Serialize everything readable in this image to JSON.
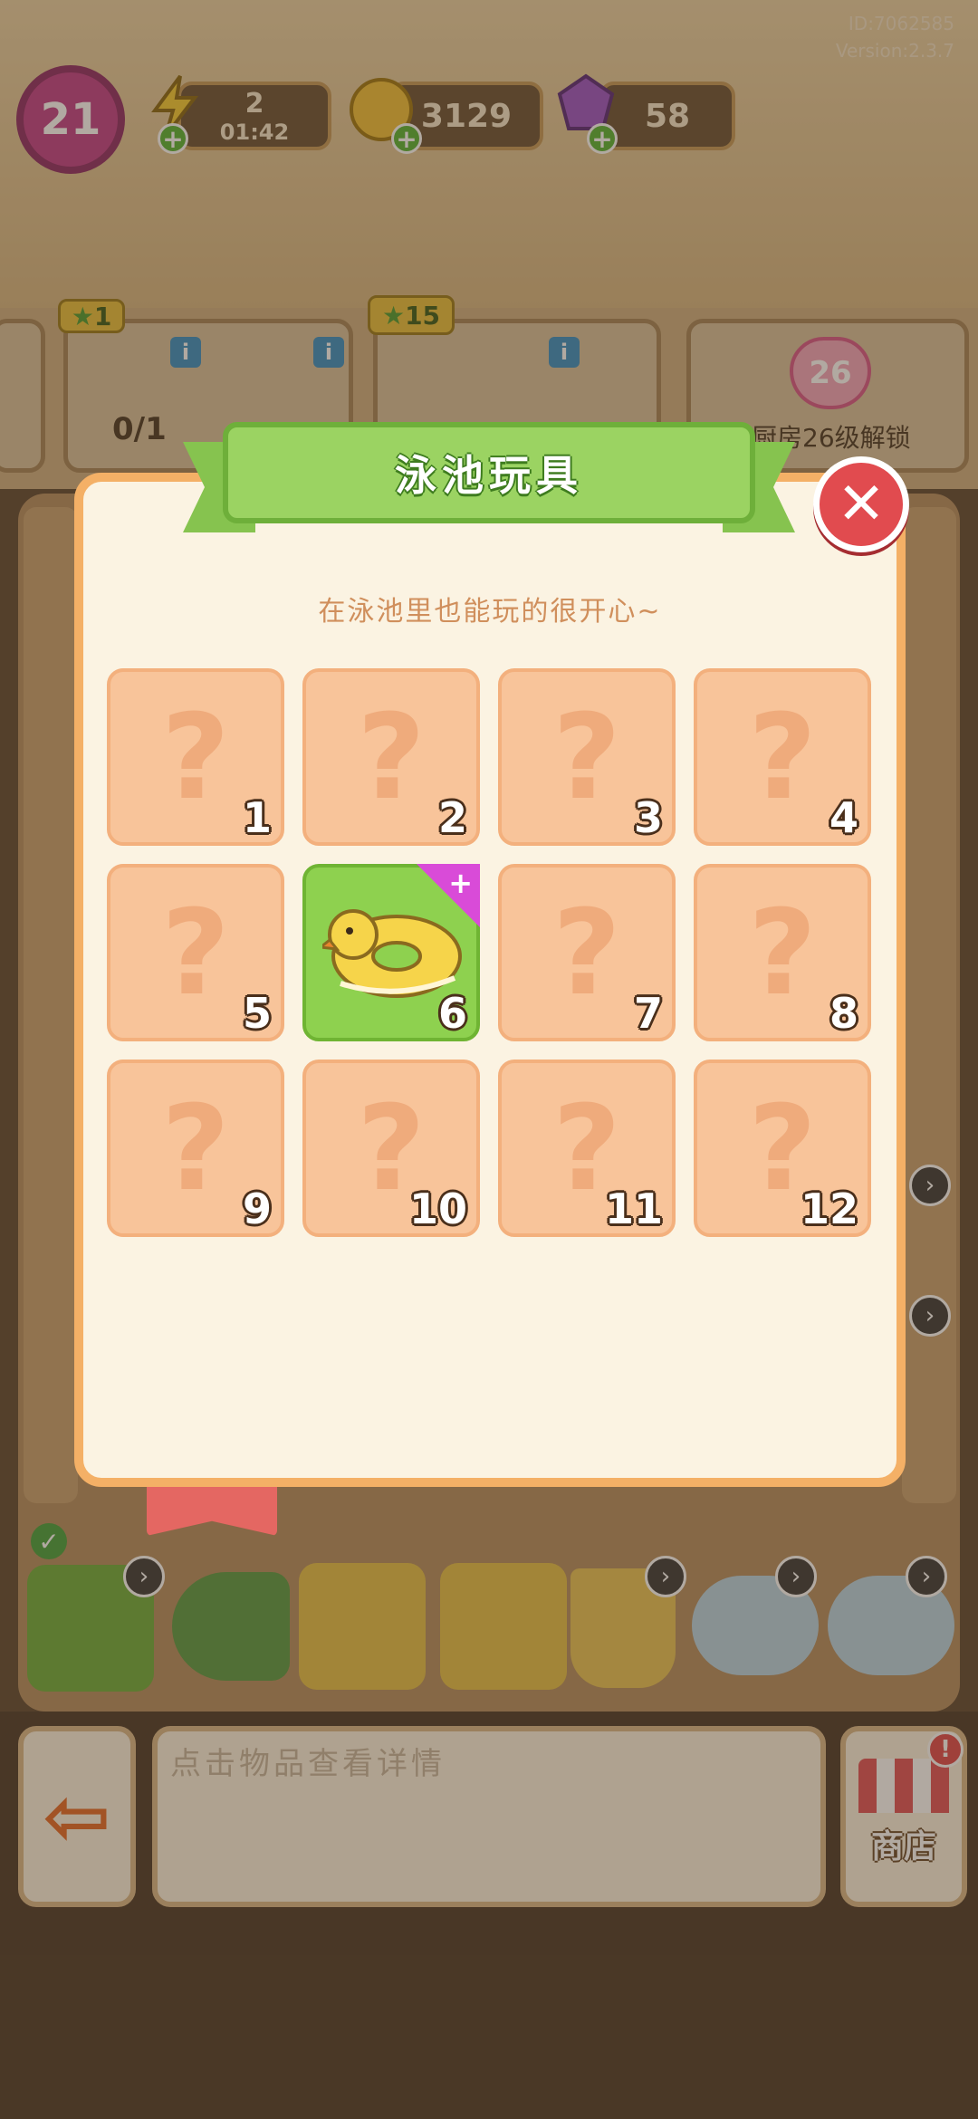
{
  "header": {
    "id_text": "ID:7062585",
    "version_text": "Version:2.3.7"
  },
  "player": {
    "level": "21",
    "energy": "2",
    "energy_timer": "01:42",
    "coins": "3129",
    "gems": "58"
  },
  "background_cards": {
    "card1_tag": "1",
    "card1_progress": "0/1",
    "card2_tag": "15",
    "card3_level": "26",
    "card3_caption": "厨房26级解锁"
  },
  "dialog": {
    "title": "泳池玩具",
    "subtitle": "在泳池里也能玩的很开心~",
    "slots": [
      {
        "number": "1",
        "state": "locked"
      },
      {
        "number": "2",
        "state": "locked"
      },
      {
        "number": "3",
        "state": "locked"
      },
      {
        "number": "4",
        "state": "locked"
      },
      {
        "number": "5",
        "state": "locked"
      },
      {
        "number": "6",
        "state": "unlocked",
        "item": "duck-swim-ring"
      },
      {
        "number": "7",
        "state": "locked"
      },
      {
        "number": "8",
        "state": "locked"
      },
      {
        "number": "9",
        "state": "locked"
      },
      {
        "number": "10",
        "state": "locked"
      },
      {
        "number": "11",
        "state": "locked"
      },
      {
        "number": "12",
        "state": "locked"
      }
    ],
    "locked_symbol": "?",
    "close_symbol": "✕",
    "new_badge_symbol": "+"
  },
  "bottom": {
    "detail_placeholder": "点击物品查看详情",
    "shop_label": "商店",
    "shop_alert": "!"
  },
  "colors": {
    "dialog_border": "#f4b066",
    "banner_green": "#9bd362",
    "slot_locked": "#f8c49a",
    "slot_unlocked": "#8ed14f",
    "close_red": "#e14b4f",
    "new_badge": "#d94bd8"
  },
  "icons": {
    "energy": "lightning-icon",
    "coin": "coin-icon",
    "gem": "gem-icon",
    "close": "close-icon",
    "exit": "exit-door-icon",
    "shop": "shop-stall-icon"
  }
}
